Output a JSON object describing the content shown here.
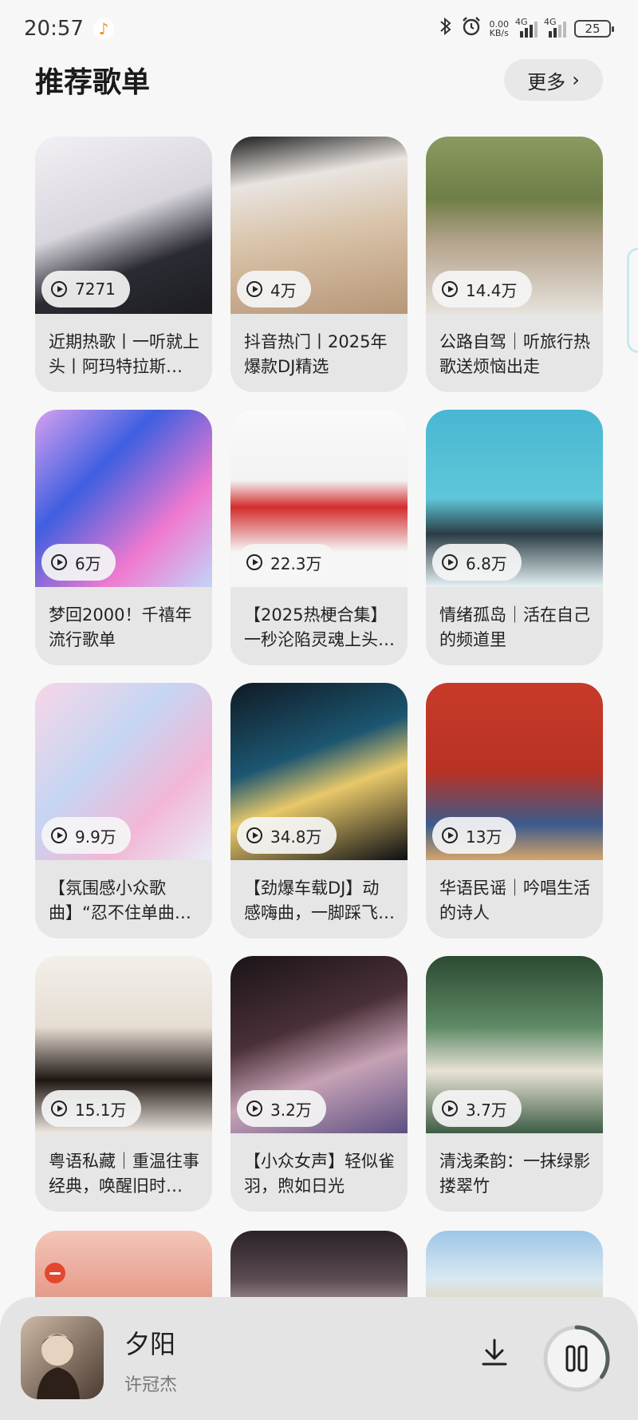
{
  "status_bar": {
    "time": "20:57",
    "speed_value": "0.00",
    "speed_unit": "KB/s",
    "signal1_label": "4G",
    "signal2_label": "4G",
    "battery": "25"
  },
  "header": {
    "title": "推荐歌单",
    "more_label": "更多",
    "more_chevron": "›"
  },
  "playlists": [
    {
      "plays": "7271",
      "title": "近期热歌丨一听就上头丨阿玛特拉斯…"
    },
    {
      "plays": "4万",
      "title": "抖音热门丨2025年爆款DJ精选"
    },
    {
      "plays": "14.4万",
      "title": "公路自驾｜听旅行热歌送烦恼出走"
    },
    {
      "plays": "6万",
      "title": "梦回2000！千禧年流行歌单"
    },
    {
      "plays": "22.3万",
      "title": "【2025热梗合集】一秒沦陷灵魂上头…"
    },
    {
      "plays": "6.8万",
      "title": "情绪孤岛｜活在自己的频道里"
    },
    {
      "plays": "9.9万",
      "title": "【氛围感小众歌曲】“忍不住单曲…"
    },
    {
      "plays": "34.8万",
      "title": "【劲爆车载DJ】动感嗨曲，一脚踩飞…"
    },
    {
      "plays": "13万",
      "title": "华语民谣｜吟唱生活的诗人"
    },
    {
      "plays": "15.1万",
      "title": "粤语私藏｜重温往事经典，唤醒旧时…"
    },
    {
      "plays": "3.2万",
      "title": "【小众女声】轻似雀羽，煦如日光"
    },
    {
      "plays": "3.7万",
      "title": "清浅柔韵：一抹绿影搂翠竹"
    }
  ],
  "covers": [
    {
      "bg": "linear-gradient(160deg,#f2f0f4 0%,#d9d6de 45%,#2b2b33 70%,#1c1c22 100%)",
      "name": "anime-boy-cover"
    },
    {
      "bg": "linear-gradient(170deg,#1d1d1d 0%,#e9e4e0 25%,#d8c2a8 55%,#b79778 100%)",
      "name": "headphone-girl-cover"
    },
    {
      "bg": "linear-gradient(180deg,#8a9a60 0%,#6f7e47 35%,#b5a48e 60%,#e6e2dc 100%)",
      "name": "road-trip-cover"
    },
    {
      "bg": "linear-gradient(135deg,#d6a0f0 0%,#3f5fe0 35%,#f07ad0 70%,#c0d6f8 100%)",
      "name": "y2k-cover"
    },
    {
      "bg": "linear-gradient(180deg,#fafafa 0%,#f2f2f2 40%,#d32c2c 55%,#f5f5f5 80%)",
      "name": "ultraman-cover"
    },
    {
      "bg": "linear-gradient(180deg,#48b7d2 0%,#5fc6d8 50%,#2a3d45 70%,#e6f2f4 100%)",
      "name": "cat-island-cover"
    },
    {
      "bg": "linear-gradient(135deg,#f7d6e8 0%,#c6d5f2 40%,#f2b7d6 70%,#e8eef8 100%)",
      "name": "butterfly-cover"
    },
    {
      "bg": "linear-gradient(160deg,#0f1a24 0%,#1c5670 40%,#e8c86a 60%,#0b0d12 100%)",
      "name": "car-night-cover"
    },
    {
      "bg": "linear-gradient(180deg,#c73a2a 0%,#b83224 50%,#3b5b8c 80%,#d6a46a 100%)",
      "name": "folk-singer-cover"
    },
    {
      "bg": "linear-gradient(180deg,#f2efea 0%,#e6ddd2 40%,#1e1612 70%,#efe9e2 100%)",
      "name": "cantonese-cover"
    },
    {
      "bg": "linear-gradient(160deg,#1a1418 0%,#4a3038 40%,#c6a2b6 65%,#5d4f82 100%)",
      "name": "female-voice-cover"
    },
    {
      "bg": "linear-gradient(180deg,#2c4a32 0%,#5f8a66 40%,#e8e2d6 65%,#3d5d44 100%)",
      "name": "green-bamboo-cover"
    }
  ],
  "partial_covers": [
    {
      "bg": "linear-gradient(180deg,#f3c6b8 0%,#e8a090 60%,#d28a7a 100%)",
      "name": "sunset-cover"
    },
    {
      "bg": "linear-gradient(180deg,#2a2226 0%,#5a4a52 50%,#d8c8c0 100%)",
      "name": "night-cover"
    },
    {
      "bg": "linear-gradient(180deg,#9ec6e8 0%,#d8e8f2 50%,#e8c890 100%)",
      "name": "city-lights-cover"
    }
  ],
  "player": {
    "song_title": "夕阳",
    "artist": "许冠杰",
    "progress": 0.35,
    "accent": "#555f60"
  }
}
